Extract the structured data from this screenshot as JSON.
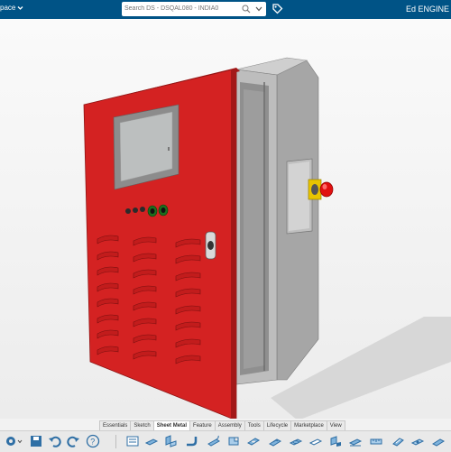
{
  "header": {
    "workspace_label": "pace",
    "search_placeholder": "Search DS - DSQAL080 - INDIA0",
    "brand_text": "Ed ENGINE"
  },
  "tabs": [
    {
      "label": "Essentials"
    },
    {
      "label": "Sketch"
    },
    {
      "label": "Sheet Metal"
    },
    {
      "label": "Feature"
    },
    {
      "label": "Assembly"
    },
    {
      "label": "Tools"
    },
    {
      "label": "Lifecycle"
    },
    {
      "label": "Marketplace"
    },
    {
      "label": "View"
    }
  ],
  "active_tab": "Sheet Metal",
  "colors": {
    "header_bg": "#005386",
    "door_red": "#d42222",
    "cabinet_grey": "#b8b8b8",
    "estop_red": "#e01010",
    "estop_yellow": "#e8c400"
  },
  "model": {
    "object": "electrical-enclosure",
    "door_state": "open"
  }
}
